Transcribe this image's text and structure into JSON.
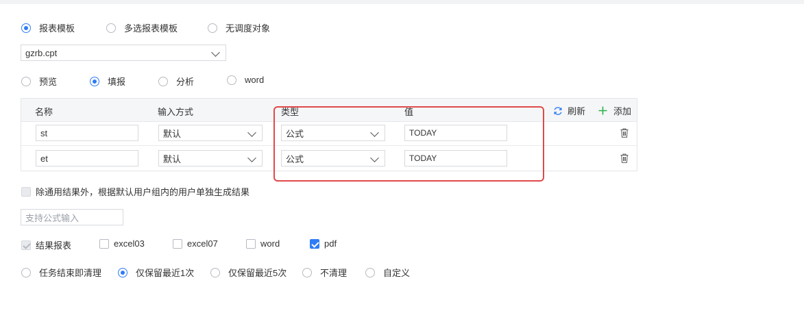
{
  "template_type": {
    "options": [
      "报表模板",
      "多选报表模板",
      "无调度对象"
    ],
    "selected": 0
  },
  "template_file": {
    "value": "gzrb.cpt"
  },
  "mode": {
    "options": [
      "预览",
      "填报",
      "分析",
      "word"
    ],
    "selected": 1
  },
  "params_table": {
    "headers": [
      "名称",
      "输入方式",
      "类型",
      "值"
    ],
    "refresh_label": "刷新",
    "add_label": "添加",
    "rows": [
      {
        "name": "st",
        "input_mode": "默认",
        "type": "公式",
        "value": "TODAY"
      },
      {
        "name": "et",
        "input_mode": "默认",
        "type": "公式",
        "value": "TODAY"
      }
    ]
  },
  "per_user_option": {
    "label": "除通用结果外，根据默认用户组内的用户单独生成结果",
    "checked": false,
    "disabled": true
  },
  "formula_input": {
    "placeholder": "支持公式输入",
    "value": ""
  },
  "result_formats": {
    "items": [
      {
        "label": "结果报表",
        "checked": true,
        "disabled": true
      },
      {
        "label": "excel03",
        "checked": false,
        "disabled": false
      },
      {
        "label": "excel07",
        "checked": false,
        "disabled": false
      },
      {
        "label": "word",
        "checked": false,
        "disabled": false
      },
      {
        "label": "pdf",
        "checked": true,
        "disabled": false
      }
    ]
  },
  "cleanup": {
    "options": [
      "任务结束即清理",
      "仅保留最近1次",
      "仅保留最近5次",
      "不清理",
      "自定义"
    ],
    "selected": 1
  },
  "colors": {
    "accent": "#2f7cf6",
    "highlight": "#e04848",
    "add_green": "#2bb24c"
  }
}
